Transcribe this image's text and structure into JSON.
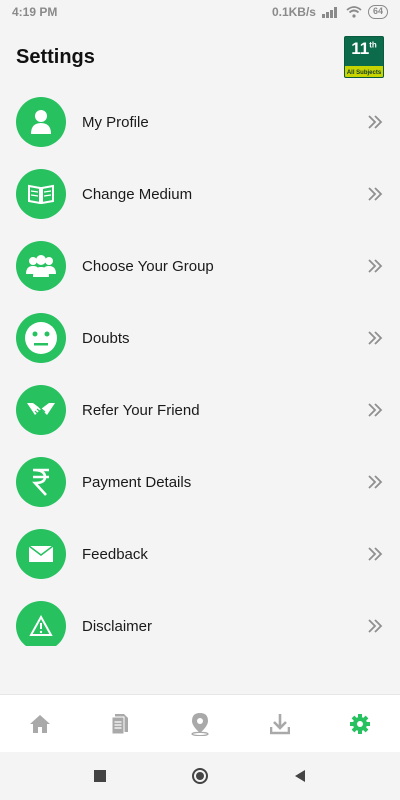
{
  "status": {
    "time": "4:19 PM",
    "network": "0.1KB/s",
    "battery": "64"
  },
  "header": {
    "title": "Settings",
    "logo": {
      "grade": "11",
      "grade_suffix": "th",
      "subtitle": "All Subjects"
    }
  },
  "settings": {
    "items": [
      {
        "label": "My Profile",
        "icon": "user-icon"
      },
      {
        "label": "Change Medium",
        "icon": "book-icon"
      },
      {
        "label": "Choose Your Group",
        "icon": "group-icon"
      },
      {
        "label": "Doubts",
        "icon": "face-icon"
      },
      {
        "label": "Refer Your Friend",
        "icon": "handshake-icon"
      },
      {
        "label": "Payment Details",
        "icon": "rupee-icon"
      },
      {
        "label": "Feedback",
        "icon": "envelope-icon"
      },
      {
        "label": "Disclaimer",
        "icon": "warning-icon"
      }
    ]
  },
  "bottom_nav": {
    "items": [
      "home-icon",
      "document-icon",
      "location-icon",
      "download-icon",
      "settings-icon"
    ],
    "active": "settings-icon"
  },
  "colors": {
    "accent": "#27c160",
    "nav_inactive": "#a9a9a9"
  }
}
